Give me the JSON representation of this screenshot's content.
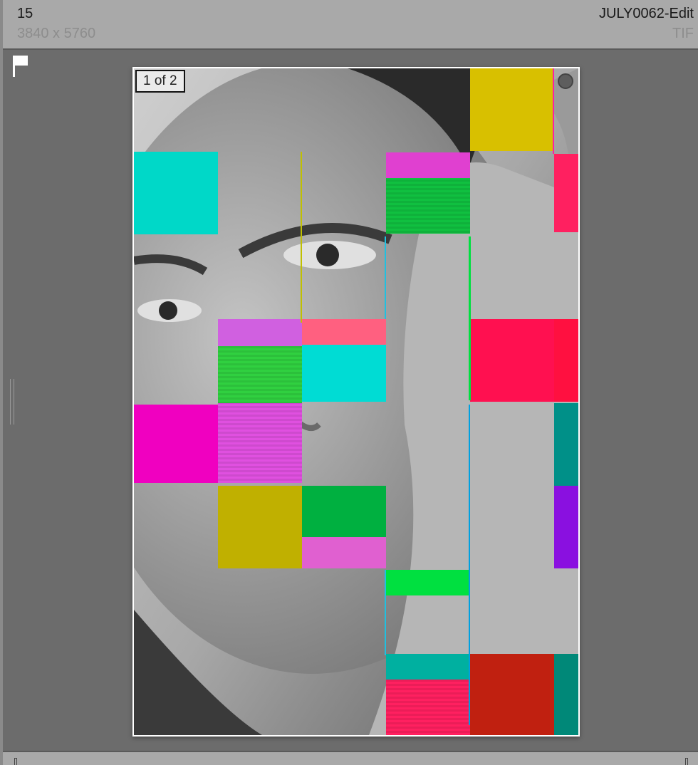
{
  "header": {
    "index": "15",
    "dimensions": "3840 x 5760",
    "filename": "JULY0062-Edit",
    "filetype": "TIF"
  },
  "badge": "1 of 2",
  "icons": {
    "flag": "flag-icon",
    "selection": "selection-circle-icon"
  },
  "colors": {
    "header_bg": "#a9a9a9",
    "cell_bg": "#6c6c6c",
    "frame": "#ffffff"
  }
}
